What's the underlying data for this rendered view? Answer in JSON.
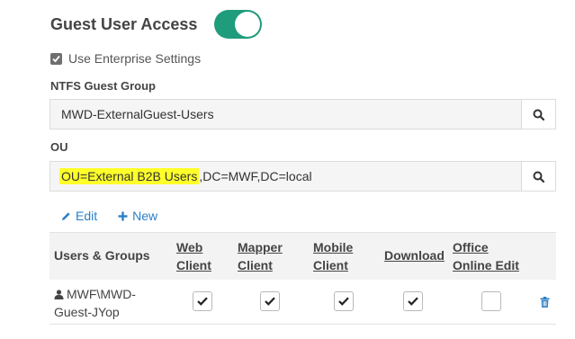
{
  "guest_access": {
    "title": "Guest User Access",
    "enabled": true
  },
  "enterprise": {
    "label": "Use Enterprise Settings",
    "checked": true
  },
  "ntfs_group": {
    "label": "NTFS Guest Group",
    "value": "MWD-ExternalGuest-Users"
  },
  "ou": {
    "label": "OU",
    "value_highlighted": "OU=External B2B Users",
    "value_rest": ",DC=MWF,DC=local"
  },
  "actions": {
    "edit_label": "Edit",
    "new_label": "New"
  },
  "table": {
    "headers": {
      "users_groups": "Users & Groups",
      "web_client_1": "Web",
      "web_client_2": "Client",
      "mapper_client_1": "Mapper",
      "mapper_client_2": "Client",
      "mobile_client_1": "Mobile",
      "mobile_client_2": "Client",
      "download": "Download",
      "office_1": "Office",
      "office_2": "Online Edit"
    },
    "rows": [
      {
        "name": "MWF\\MWD-Guest-JYop",
        "web_client": true,
        "mapper_client": true,
        "mobile_client": true,
        "download": true,
        "office_online_edit": false
      }
    ]
  },
  "colors": {
    "accent_green": "#1f9c7b",
    "link_blue": "#2a7fc7",
    "highlight_yellow": "#ffff29"
  }
}
